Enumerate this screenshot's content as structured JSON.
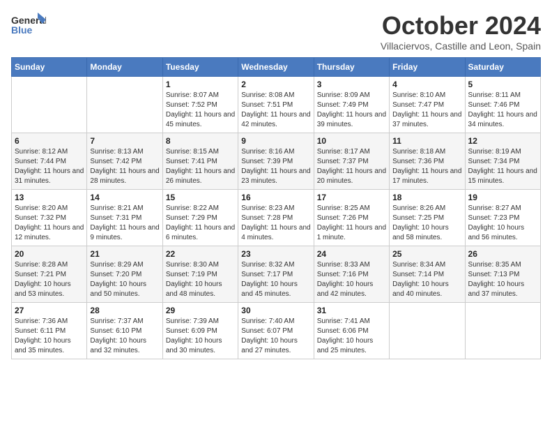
{
  "header": {
    "logo_general": "General",
    "logo_blue": "Blue",
    "month": "October 2024",
    "location": "Villaciervos, Castille and Leon, Spain"
  },
  "weekdays": [
    "Sunday",
    "Monday",
    "Tuesday",
    "Wednesday",
    "Thursday",
    "Friday",
    "Saturday"
  ],
  "weeks": [
    [
      {
        "day": "",
        "sunrise": "",
        "sunset": "",
        "daylight": ""
      },
      {
        "day": "",
        "sunrise": "",
        "sunset": "",
        "daylight": ""
      },
      {
        "day": "1",
        "sunrise": "Sunrise: 8:07 AM",
        "sunset": "Sunset: 7:52 PM",
        "daylight": "Daylight: 11 hours and 45 minutes."
      },
      {
        "day": "2",
        "sunrise": "Sunrise: 8:08 AM",
        "sunset": "Sunset: 7:51 PM",
        "daylight": "Daylight: 11 hours and 42 minutes."
      },
      {
        "day": "3",
        "sunrise": "Sunrise: 8:09 AM",
        "sunset": "Sunset: 7:49 PM",
        "daylight": "Daylight: 11 hours and 39 minutes."
      },
      {
        "day": "4",
        "sunrise": "Sunrise: 8:10 AM",
        "sunset": "Sunset: 7:47 PM",
        "daylight": "Daylight: 11 hours and 37 minutes."
      },
      {
        "day": "5",
        "sunrise": "Sunrise: 8:11 AM",
        "sunset": "Sunset: 7:46 PM",
        "daylight": "Daylight: 11 hours and 34 minutes."
      }
    ],
    [
      {
        "day": "6",
        "sunrise": "Sunrise: 8:12 AM",
        "sunset": "Sunset: 7:44 PM",
        "daylight": "Daylight: 11 hours and 31 minutes."
      },
      {
        "day": "7",
        "sunrise": "Sunrise: 8:13 AM",
        "sunset": "Sunset: 7:42 PM",
        "daylight": "Daylight: 11 hours and 28 minutes."
      },
      {
        "day": "8",
        "sunrise": "Sunrise: 8:15 AM",
        "sunset": "Sunset: 7:41 PM",
        "daylight": "Daylight: 11 hours and 26 minutes."
      },
      {
        "day": "9",
        "sunrise": "Sunrise: 8:16 AM",
        "sunset": "Sunset: 7:39 PM",
        "daylight": "Daylight: 11 hours and 23 minutes."
      },
      {
        "day": "10",
        "sunrise": "Sunrise: 8:17 AM",
        "sunset": "Sunset: 7:37 PM",
        "daylight": "Daylight: 11 hours and 20 minutes."
      },
      {
        "day": "11",
        "sunrise": "Sunrise: 8:18 AM",
        "sunset": "Sunset: 7:36 PM",
        "daylight": "Daylight: 11 hours and 17 minutes."
      },
      {
        "day": "12",
        "sunrise": "Sunrise: 8:19 AM",
        "sunset": "Sunset: 7:34 PM",
        "daylight": "Daylight: 11 hours and 15 minutes."
      }
    ],
    [
      {
        "day": "13",
        "sunrise": "Sunrise: 8:20 AM",
        "sunset": "Sunset: 7:32 PM",
        "daylight": "Daylight: 11 hours and 12 minutes."
      },
      {
        "day": "14",
        "sunrise": "Sunrise: 8:21 AM",
        "sunset": "Sunset: 7:31 PM",
        "daylight": "Daylight: 11 hours and 9 minutes."
      },
      {
        "day": "15",
        "sunrise": "Sunrise: 8:22 AM",
        "sunset": "Sunset: 7:29 PM",
        "daylight": "Daylight: 11 hours and 6 minutes."
      },
      {
        "day": "16",
        "sunrise": "Sunrise: 8:23 AM",
        "sunset": "Sunset: 7:28 PM",
        "daylight": "Daylight: 11 hours and 4 minutes."
      },
      {
        "day": "17",
        "sunrise": "Sunrise: 8:25 AM",
        "sunset": "Sunset: 7:26 PM",
        "daylight": "Daylight: 11 hours and 1 minute."
      },
      {
        "day": "18",
        "sunrise": "Sunrise: 8:26 AM",
        "sunset": "Sunset: 7:25 PM",
        "daylight": "Daylight: 10 hours and 58 minutes."
      },
      {
        "day": "19",
        "sunrise": "Sunrise: 8:27 AM",
        "sunset": "Sunset: 7:23 PM",
        "daylight": "Daylight: 10 hours and 56 minutes."
      }
    ],
    [
      {
        "day": "20",
        "sunrise": "Sunrise: 8:28 AM",
        "sunset": "Sunset: 7:21 PM",
        "daylight": "Daylight: 10 hours and 53 minutes."
      },
      {
        "day": "21",
        "sunrise": "Sunrise: 8:29 AM",
        "sunset": "Sunset: 7:20 PM",
        "daylight": "Daylight: 10 hours and 50 minutes."
      },
      {
        "day": "22",
        "sunrise": "Sunrise: 8:30 AM",
        "sunset": "Sunset: 7:19 PM",
        "daylight": "Daylight: 10 hours and 48 minutes."
      },
      {
        "day": "23",
        "sunrise": "Sunrise: 8:32 AM",
        "sunset": "Sunset: 7:17 PM",
        "daylight": "Daylight: 10 hours and 45 minutes."
      },
      {
        "day": "24",
        "sunrise": "Sunrise: 8:33 AM",
        "sunset": "Sunset: 7:16 PM",
        "daylight": "Daylight: 10 hours and 42 minutes."
      },
      {
        "day": "25",
        "sunrise": "Sunrise: 8:34 AM",
        "sunset": "Sunset: 7:14 PM",
        "daylight": "Daylight: 10 hours and 40 minutes."
      },
      {
        "day": "26",
        "sunrise": "Sunrise: 8:35 AM",
        "sunset": "Sunset: 7:13 PM",
        "daylight": "Daylight: 10 hours and 37 minutes."
      }
    ],
    [
      {
        "day": "27",
        "sunrise": "Sunrise: 7:36 AM",
        "sunset": "Sunset: 6:11 PM",
        "daylight": "Daylight: 10 hours and 35 minutes."
      },
      {
        "day": "28",
        "sunrise": "Sunrise: 7:37 AM",
        "sunset": "Sunset: 6:10 PM",
        "daylight": "Daylight: 10 hours and 32 minutes."
      },
      {
        "day": "29",
        "sunrise": "Sunrise: 7:39 AM",
        "sunset": "Sunset: 6:09 PM",
        "daylight": "Daylight: 10 hours and 30 minutes."
      },
      {
        "day": "30",
        "sunrise": "Sunrise: 7:40 AM",
        "sunset": "Sunset: 6:07 PM",
        "daylight": "Daylight: 10 hours and 27 minutes."
      },
      {
        "day": "31",
        "sunrise": "Sunrise: 7:41 AM",
        "sunset": "Sunset: 6:06 PM",
        "daylight": "Daylight: 10 hours and 25 minutes."
      },
      {
        "day": "",
        "sunrise": "",
        "sunset": "",
        "daylight": ""
      },
      {
        "day": "",
        "sunrise": "",
        "sunset": "",
        "daylight": ""
      }
    ]
  ]
}
